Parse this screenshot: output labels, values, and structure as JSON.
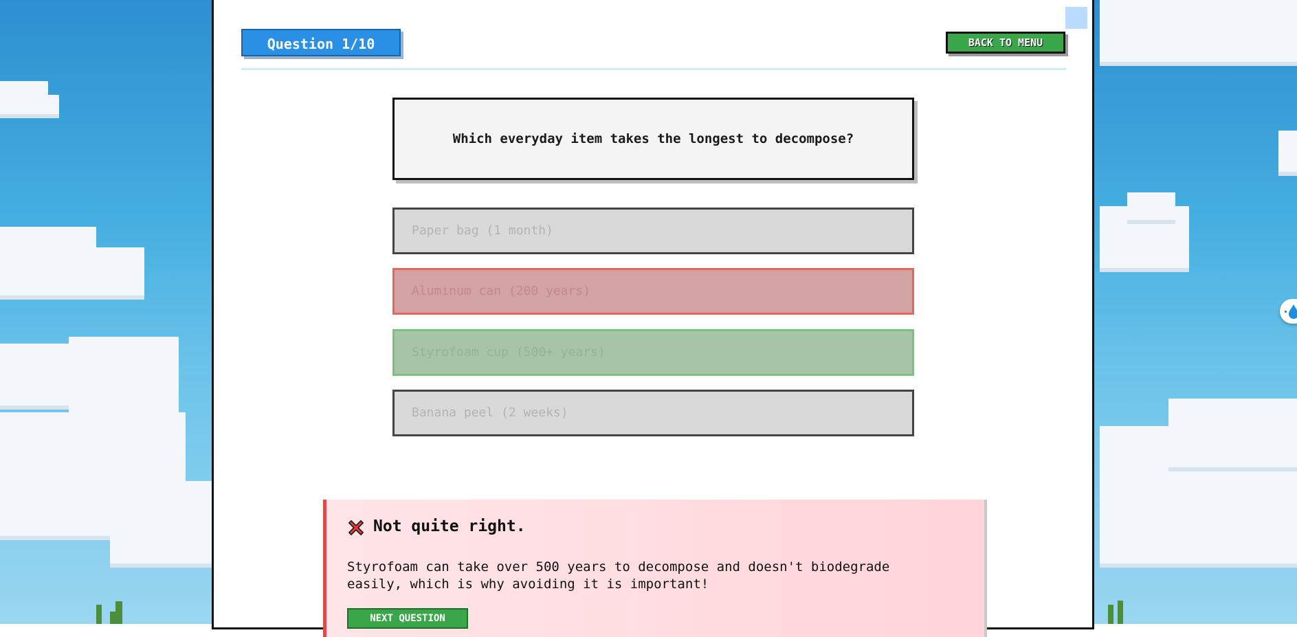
{
  "header": {
    "question_counter": "Question 1/10",
    "back_label": "BACK TO MENU"
  },
  "question": {
    "text": "Which everyday item takes the longest to decompose?"
  },
  "options": [
    {
      "label": "Paper bag (1 month)",
      "state": "neutral"
    },
    {
      "label": "Aluminum can (200 years)",
      "state": "selected-wrong"
    },
    {
      "label": "Styrofoam cup (500+ years)",
      "state": "correct"
    },
    {
      "label": "Banana peel (2 weeks)",
      "state": "neutral"
    }
  ],
  "feedback": {
    "icon": "cross-icon",
    "title": "Not quite right.",
    "text": "Styrofoam can take over 500 years to decompose and doesn't biodegrade easily, which is why avoiding it is important!",
    "next_label": "NEXT QUESTION"
  },
  "side_widget": {
    "icon": "water-drop-icon"
  },
  "colors": {
    "accent_blue": "#2a90e6",
    "button_green": "#3aa64a",
    "wrong_red": "#e04a4a",
    "correct_green": "#7cc27f"
  }
}
